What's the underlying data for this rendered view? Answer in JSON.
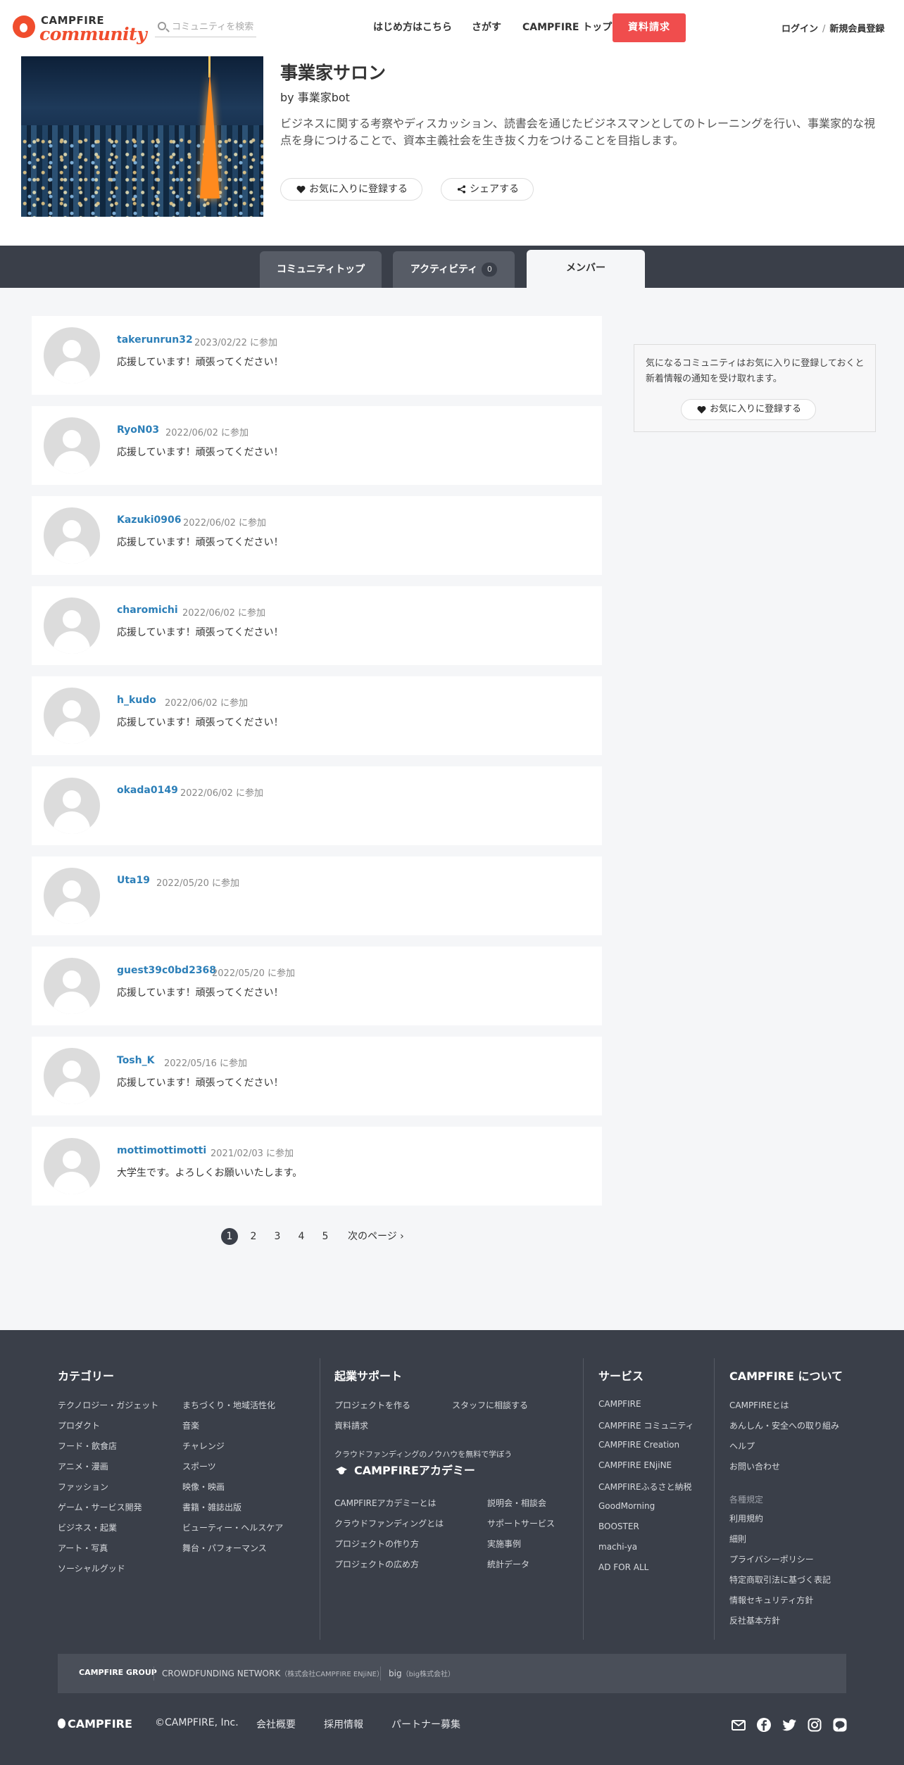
{
  "header": {
    "logo_top": "CAMPFIRE",
    "logo_bottom": "community",
    "search_placeholder": "コミュニティを検索",
    "nav": [
      "はじめ方はこちら",
      "さがす",
      "CAMPFIRE トップ"
    ],
    "cta": "資料請求",
    "login": "ログイン",
    "separator": "/",
    "signup": "新規会員登録"
  },
  "community": {
    "title": "事業家サロン",
    "by_prefix": "by",
    "owner": "事業家bot",
    "description": "ビジネスに関する考察やディスカッション、読書会を通じたビジネスマンとしてのトレーニングを行い、事業家的な視点を身につけることで、資本主義社会を生き抜く力をつけることを目指します。",
    "favorite_button": "お気に入りに登録する",
    "share_button": "シェアする"
  },
  "tabs": [
    {
      "label": "コミュニティトップ",
      "count": ""
    },
    {
      "label": "アクティビティ",
      "count": "0"
    },
    {
      "label": "メンバー",
      "count": ""
    }
  ],
  "members": [
    {
      "name": "takerunrun32",
      "joined": "2023/02/22 に参加",
      "message": "応援しています！頑張ってください！"
    },
    {
      "name": "RyoN03",
      "joined": "2022/06/02 に参加",
      "message": "応援しています！頑張ってください！"
    },
    {
      "name": "Kazuki0906",
      "joined": "2022/06/02 に参加",
      "message": "応援しています！頑張ってください！"
    },
    {
      "name": "charomichi",
      "joined": "2022/06/02 に参加",
      "message": "応援しています！頑張ってください！"
    },
    {
      "name": "h_kudo",
      "joined": "2022/06/02 に参加",
      "message": "応援しています！頑張ってください！"
    },
    {
      "name": "okada0149",
      "joined": "2022/06/02 に参加",
      "message": ""
    },
    {
      "name": "Uta19",
      "joined": "2022/05/20 に参加",
      "message": ""
    },
    {
      "name": "guest39c0bd2368",
      "joined": "2022/05/20 に参加",
      "message": "応援しています！頑張ってください！"
    },
    {
      "name": "Tosh_K",
      "joined": "2022/05/16 に参加",
      "message": "応援しています！頑張ってください！"
    },
    {
      "name": "mottimottimotti",
      "joined": "2021/02/03 に参加",
      "message": "大学生です。よろしくお願いいたします。"
    }
  ],
  "pagination": {
    "pages": [
      "1",
      "2",
      "3",
      "4",
      "5"
    ],
    "current": "1",
    "next": "次のページ ›"
  },
  "sidebar": {
    "text": "気になるコミュニティはお気に入りに登録しておくと新着情報の通知を受け取れます。",
    "button": "お気に入りに登録する"
  },
  "footer": {
    "category": {
      "heading": "カテゴリー",
      "col1": [
        "テクノロジー・ガジェット",
        "プロダクト",
        "フード・飲食店",
        "アニメ・漫画",
        "ファッション",
        "ゲーム・サービス開発",
        "ビジネス・起業",
        "アート・写真",
        "ソーシャルグッド"
      ],
      "col2": [
        "まちづくり・地域活性化",
        "音楽",
        "チャレンジ",
        "スポーツ",
        "映像・映画",
        "書籍・雑誌出版",
        "ビューティー・ヘルスケア",
        "舞台・パフォーマンス"
      ]
    },
    "support": {
      "heading": "起業サポート",
      "links": [
        "プロジェクトを作る",
        "スタッフに相談する",
        "資料請求"
      ],
      "academy_note": "クラウドファンディングのノウハウを無料で学ぼう",
      "academy_title": "CAMPFIREアカデミー",
      "academy_col1": [
        "CAMPFIREアカデミーとは",
        "クラウドファンディングとは",
        "プロジェクトの作り方",
        "プロジェクトの広め方"
      ],
      "academy_col2": [
        "説明会・相談会",
        "サポートサービス",
        "実施事例",
        "統計データ"
      ]
    },
    "services": {
      "heading": "サービス",
      "links": [
        "CAMPFIRE",
        "CAMPFIRE コミュニティ",
        "CAMPFIRE Creation",
        "CAMPFIRE ENjiNE",
        "CAMPFIREふるさと納税",
        "GoodMorning",
        "BOOSTER",
        "machi-ya",
        "AD FOR ALL"
      ]
    },
    "about": {
      "heading": "CAMPFIRE について",
      "links": [
        "CAMPFIREとは",
        "あんしん・安全への取り組み",
        "ヘルプ",
        "お問い合わせ"
      ],
      "regs_heading": "各種規定",
      "regs": [
        "利用規約",
        "細則",
        "プライバシーポリシー",
        "特定商取引法に基づく表記",
        "情報セキュリティ方針",
        "反社基本方針"
      ]
    },
    "group": {
      "label": "CAMPFIRE GROUP",
      "item1": "CROWDFUNDING NETWORK",
      "item1_note": "（株式会社CAMPFIRE ENjiNE）",
      "item2": "big",
      "item2_note": "（big株式会社）"
    },
    "bottom": {
      "logo": "CAMPFIRE",
      "copyright": "©CAMPFIRE, Inc.",
      "links": [
        "会社概要",
        "採用情報",
        "パートナー募集"
      ]
    },
    "social_icons": [
      "mail-icon",
      "facebook-icon",
      "twitter-icon",
      "instagram-icon",
      "line-icon"
    ]
  }
}
